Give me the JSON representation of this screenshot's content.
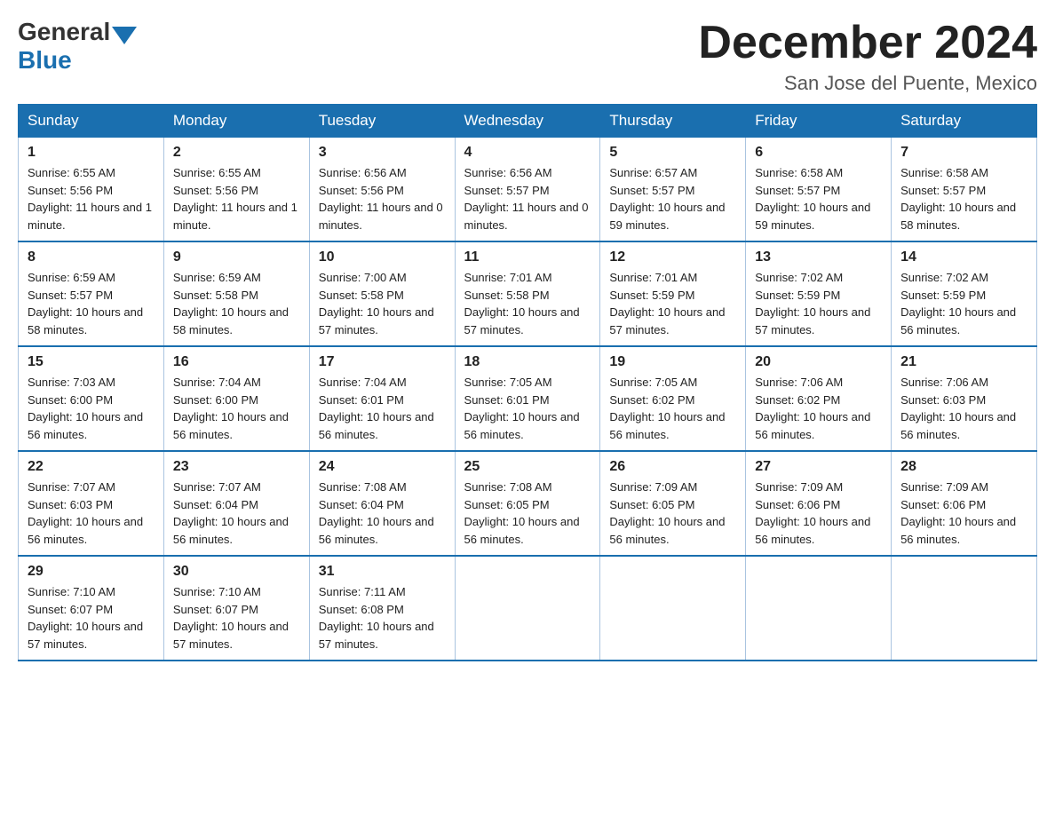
{
  "header": {
    "logo": {
      "general": "General",
      "blue": "Blue"
    },
    "title": "December 2024",
    "location": "San Jose del Puente, Mexico"
  },
  "days_of_week": [
    "Sunday",
    "Monday",
    "Tuesday",
    "Wednesday",
    "Thursday",
    "Friday",
    "Saturday"
  ],
  "weeks": [
    [
      {
        "date": "1",
        "sunrise": "6:55 AM",
        "sunset": "5:56 PM",
        "daylight": "11 hours and 1 minute."
      },
      {
        "date": "2",
        "sunrise": "6:55 AM",
        "sunset": "5:56 PM",
        "daylight": "11 hours and 1 minute."
      },
      {
        "date": "3",
        "sunrise": "6:56 AM",
        "sunset": "5:56 PM",
        "daylight": "11 hours and 0 minutes."
      },
      {
        "date": "4",
        "sunrise": "6:56 AM",
        "sunset": "5:57 PM",
        "daylight": "11 hours and 0 minutes."
      },
      {
        "date": "5",
        "sunrise": "6:57 AM",
        "sunset": "5:57 PM",
        "daylight": "10 hours and 59 minutes."
      },
      {
        "date": "6",
        "sunrise": "6:58 AM",
        "sunset": "5:57 PM",
        "daylight": "10 hours and 59 minutes."
      },
      {
        "date": "7",
        "sunrise": "6:58 AM",
        "sunset": "5:57 PM",
        "daylight": "10 hours and 58 minutes."
      }
    ],
    [
      {
        "date": "8",
        "sunrise": "6:59 AM",
        "sunset": "5:57 PM",
        "daylight": "10 hours and 58 minutes."
      },
      {
        "date": "9",
        "sunrise": "6:59 AM",
        "sunset": "5:58 PM",
        "daylight": "10 hours and 58 minutes."
      },
      {
        "date": "10",
        "sunrise": "7:00 AM",
        "sunset": "5:58 PM",
        "daylight": "10 hours and 57 minutes."
      },
      {
        "date": "11",
        "sunrise": "7:01 AM",
        "sunset": "5:58 PM",
        "daylight": "10 hours and 57 minutes."
      },
      {
        "date": "12",
        "sunrise": "7:01 AM",
        "sunset": "5:59 PM",
        "daylight": "10 hours and 57 minutes."
      },
      {
        "date": "13",
        "sunrise": "7:02 AM",
        "sunset": "5:59 PM",
        "daylight": "10 hours and 57 minutes."
      },
      {
        "date": "14",
        "sunrise": "7:02 AM",
        "sunset": "5:59 PM",
        "daylight": "10 hours and 56 minutes."
      }
    ],
    [
      {
        "date": "15",
        "sunrise": "7:03 AM",
        "sunset": "6:00 PM",
        "daylight": "10 hours and 56 minutes."
      },
      {
        "date": "16",
        "sunrise": "7:04 AM",
        "sunset": "6:00 PM",
        "daylight": "10 hours and 56 minutes."
      },
      {
        "date": "17",
        "sunrise": "7:04 AM",
        "sunset": "6:01 PM",
        "daylight": "10 hours and 56 minutes."
      },
      {
        "date": "18",
        "sunrise": "7:05 AM",
        "sunset": "6:01 PM",
        "daylight": "10 hours and 56 minutes."
      },
      {
        "date": "19",
        "sunrise": "7:05 AM",
        "sunset": "6:02 PM",
        "daylight": "10 hours and 56 minutes."
      },
      {
        "date": "20",
        "sunrise": "7:06 AM",
        "sunset": "6:02 PM",
        "daylight": "10 hours and 56 minutes."
      },
      {
        "date": "21",
        "sunrise": "7:06 AM",
        "sunset": "6:03 PM",
        "daylight": "10 hours and 56 minutes."
      }
    ],
    [
      {
        "date": "22",
        "sunrise": "7:07 AM",
        "sunset": "6:03 PM",
        "daylight": "10 hours and 56 minutes."
      },
      {
        "date": "23",
        "sunrise": "7:07 AM",
        "sunset": "6:04 PM",
        "daylight": "10 hours and 56 minutes."
      },
      {
        "date": "24",
        "sunrise": "7:08 AM",
        "sunset": "6:04 PM",
        "daylight": "10 hours and 56 minutes."
      },
      {
        "date": "25",
        "sunrise": "7:08 AM",
        "sunset": "6:05 PM",
        "daylight": "10 hours and 56 minutes."
      },
      {
        "date": "26",
        "sunrise": "7:09 AM",
        "sunset": "6:05 PM",
        "daylight": "10 hours and 56 minutes."
      },
      {
        "date": "27",
        "sunrise": "7:09 AM",
        "sunset": "6:06 PM",
        "daylight": "10 hours and 56 minutes."
      },
      {
        "date": "28",
        "sunrise": "7:09 AM",
        "sunset": "6:06 PM",
        "daylight": "10 hours and 56 minutes."
      }
    ],
    [
      {
        "date": "29",
        "sunrise": "7:10 AM",
        "sunset": "6:07 PM",
        "daylight": "10 hours and 57 minutes."
      },
      {
        "date": "30",
        "sunrise": "7:10 AM",
        "sunset": "6:07 PM",
        "daylight": "10 hours and 57 minutes."
      },
      {
        "date": "31",
        "sunrise": "7:11 AM",
        "sunset": "6:08 PM",
        "daylight": "10 hours and 57 minutes."
      },
      null,
      null,
      null,
      null
    ]
  ]
}
